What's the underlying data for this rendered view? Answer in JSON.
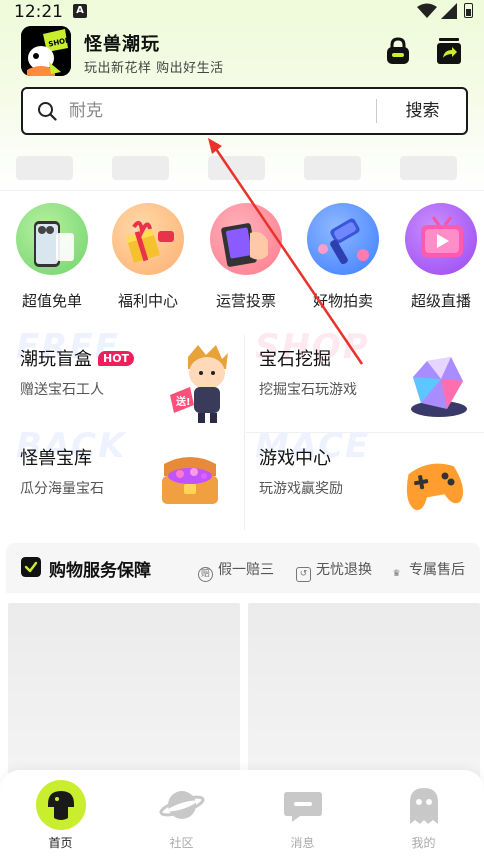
{
  "status_bar": {
    "time": "12:21",
    "notification_icon": "A"
  },
  "app": {
    "logo_text": "SHOP",
    "title": "怪兽潮玩",
    "subtitle": "玩出新花样 购出好生活",
    "header_icons": [
      "lock-bag-icon",
      "share-card-icon"
    ]
  },
  "search": {
    "placeholder": "耐克",
    "button_label": "搜索"
  },
  "categories": [
    {
      "label": "超值免单",
      "icon": "phone-gift-icon",
      "color": "#7ad97a"
    },
    {
      "label": "福利中心",
      "icon": "gift-box-icon",
      "color": "#ffb36b"
    },
    {
      "label": "运营投票",
      "icon": "vote-card-icon",
      "color": "#ff7f8f"
    },
    {
      "label": "好物拍卖",
      "icon": "auction-hammer-icon",
      "color": "#4a8cff"
    },
    {
      "label": "超级直播",
      "icon": "live-tv-icon",
      "color": "#a64df5"
    }
  ],
  "features": [
    {
      "title": "潮玩盲盒",
      "badge": "HOT",
      "subtitle": "赠送宝石工人",
      "ghost": "FREE"
    },
    {
      "title": "宝石挖掘",
      "badge": "",
      "subtitle": "挖掘宝石玩游戏",
      "ghost": "SHOP"
    },
    {
      "title": "怪兽宝库",
      "badge": "",
      "subtitle": "瓜分海量宝石",
      "ghost": "BACK"
    },
    {
      "title": "游戏中心",
      "badge": "",
      "subtitle": "玩游戏赢奖励",
      "ghost": "MACE"
    }
  ],
  "guarantee": {
    "title": "购物服务保障",
    "items": [
      {
        "icon": "赔",
        "label": "假一赔三"
      },
      {
        "icon": "↺",
        "label": "无忧退换"
      },
      {
        "icon": "♛",
        "label": "专属售后"
      }
    ]
  },
  "bottom_nav": [
    {
      "label": "首页",
      "icon": "home-monster-icon",
      "active": true
    },
    {
      "label": "社区",
      "icon": "planet-icon",
      "active": false
    },
    {
      "label": "消息",
      "icon": "message-icon",
      "active": false
    },
    {
      "label": "我的",
      "icon": "profile-ghost-icon",
      "active": false
    }
  ],
  "colors": {
    "accent": "#c9ee2e",
    "hot_badge": "#ee1f5b",
    "annotation_arrow": "#e8332b"
  }
}
